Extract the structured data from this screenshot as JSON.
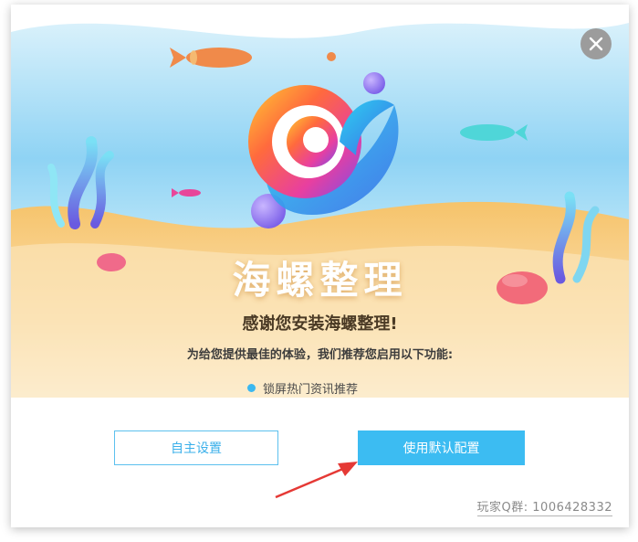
{
  "window": {
    "brand_title": "海螺整理",
    "thanks_text": "感谢您安装海螺整理!",
    "description": "为给您提供最佳的体验，我们推荐您启用以下功能:",
    "features": [
      {
        "label": "锁屏热门资讯推荐",
        "bullet_color": "#3bb8f0"
      }
    ]
  },
  "buttons": {
    "custom_label": "自主设置",
    "default_label": "使用默认配置"
  },
  "footer": {
    "qq_group": "玩家Q群: 1006428332"
  },
  "colors": {
    "accent": "#3cbcf2",
    "sky": "#7fcdf2",
    "sand": "#f5c46a",
    "close_button": "#9c9c9c",
    "annotation_arrow": "#e53935"
  },
  "icons": {
    "close": "close-icon",
    "logo": "snail-shell-logo"
  }
}
